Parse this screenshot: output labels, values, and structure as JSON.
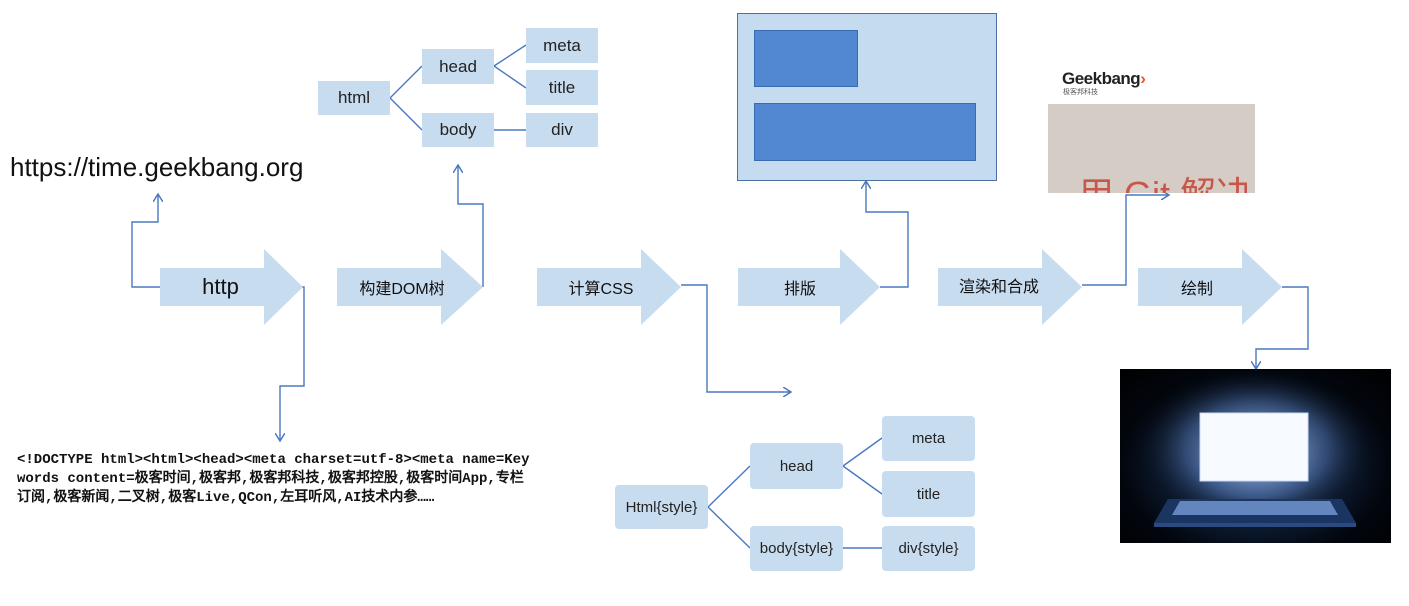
{
  "url_text": "https://time.geekbang.org",
  "pipeline": {
    "http": "http",
    "build_dom": "构建DOM树",
    "compute_css": "计算CSS",
    "layout": "排版",
    "render_composite": "渲染和合成",
    "paint": "绘制"
  },
  "dom_tree": {
    "html": "html",
    "head": "head",
    "body": "body",
    "meta": "meta",
    "title": "title",
    "div": "div"
  },
  "style_tree": {
    "html": "Html{style}",
    "head": "head",
    "body": "body{style}",
    "meta": "meta",
    "title": "title",
    "div": "div{style}"
  },
  "html_source": "<!DOCTYPE html><html><head><meta charset=utf-8><meta name=Keywords content=极客时间,极客邦,极客邦科技,极客邦控股,极客时间App,专栏订阅,极客新闻,二叉树,极客Live,QCon,左耳听风,AI技术内参……",
  "composite_image": {
    "logo_text": "Geekbang",
    "logo_sub": "极客邦科技",
    "banner_text": "用 Git 解决"
  },
  "colors": {
    "box_fill": "#c8dcf0",
    "connector": "#4a78c0",
    "layout_panel": "#c5dbf0",
    "layout_block": "#5287d1"
  }
}
